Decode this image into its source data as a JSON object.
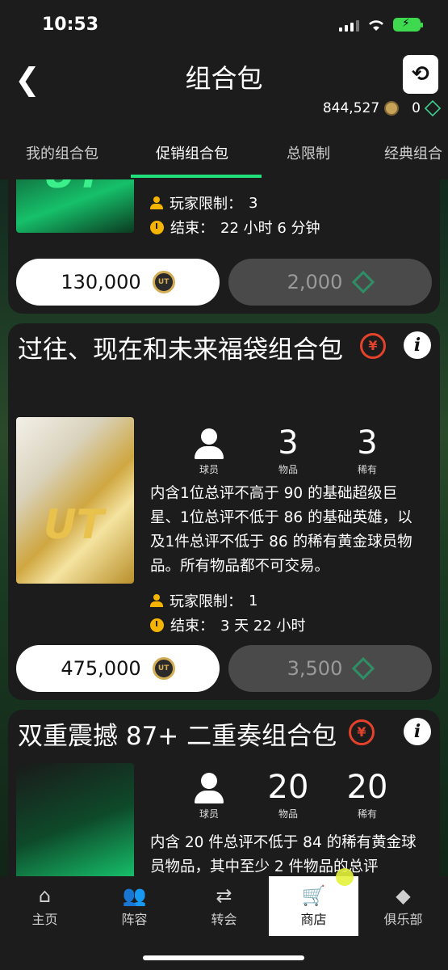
{
  "status_bar": {
    "time": "10:53"
  },
  "header": {
    "title": "组合包",
    "coins": "844,527",
    "points": "0"
  },
  "tabs": [
    "我的组合包",
    "促销组合包",
    "总限制",
    "经典组合"
  ],
  "active_tab": 1,
  "card1": {
    "player_limit_label": "玩家限制：",
    "player_limit": "3",
    "end_label": "结束：",
    "end_value": "22 小时 6 分钟",
    "price_coins": "130,000",
    "price_points": "2,000"
  },
  "card2": {
    "title": "过往、现在和未来福袋组合包",
    "stats": [
      {
        "value": "",
        "label": "球员"
      },
      {
        "value": "3",
        "label": "物品"
      },
      {
        "value": "3",
        "label": "稀有"
      }
    ],
    "description": "内含1位总评不高于 90 的基础超级巨星、1位总评不低于 86 的基础英雄，以及1件总评不低于 86 的稀有黄金球员物品。所有物品都不可交易。",
    "player_limit_label": "玩家限制：",
    "player_limit": "1",
    "end_label": "结束：",
    "end_value": "3 天 22 小时",
    "price_coins": "475,000",
    "price_points": "3,500"
  },
  "card3": {
    "title": "双重震撼 87+ 二重奏组合包",
    "stats": [
      {
        "value": "",
        "label": "球员"
      },
      {
        "value": "20",
        "label": "物品"
      },
      {
        "value": "20",
        "label": "稀有"
      }
    ],
    "description": "内含 20 件总评不低于 84 的稀有黄金球员物品，其中至少 2 件物品的总评"
  },
  "pack_art_text": "UT",
  "coin_icon_text": "UT",
  "bottom_nav": [
    {
      "label": "主页",
      "icon": "home-icon"
    },
    {
      "label": "阵容",
      "icon": "squad-icon"
    },
    {
      "label": "转会",
      "icon": "transfer-icon"
    },
    {
      "label": "商店",
      "icon": "cart-icon"
    },
    {
      "label": "俱乐部",
      "icon": "club-icon"
    }
  ],
  "colors": {
    "accent": "#1fe07a",
    "warning": "#f4b400",
    "no_trade": "#e5422b"
  }
}
